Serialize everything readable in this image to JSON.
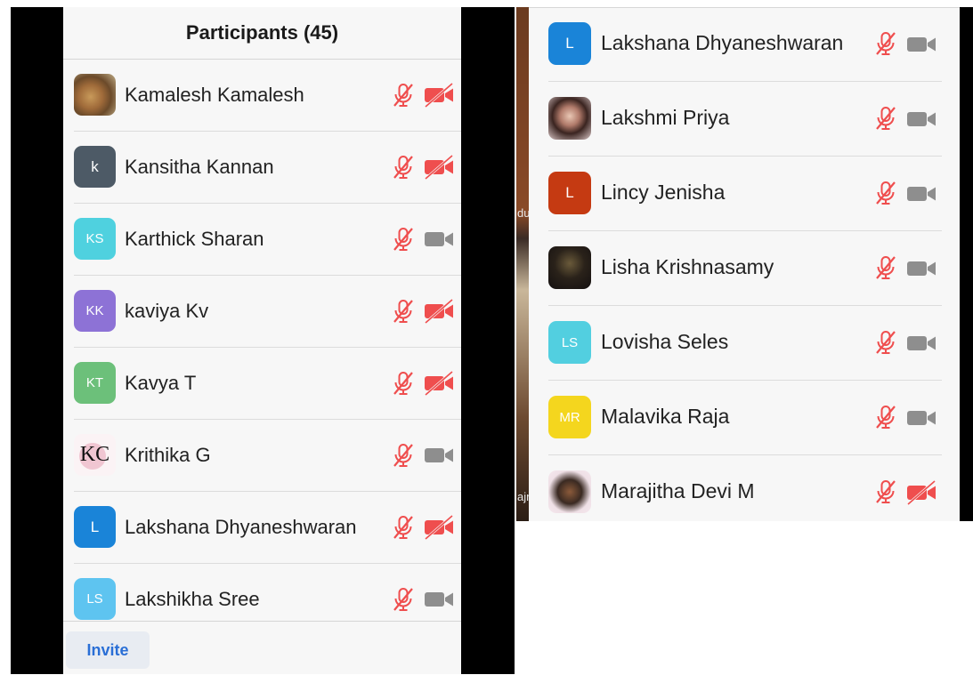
{
  "left": {
    "title": "Participants (45)",
    "invite_label": "Invite",
    "participants": [
      {
        "name": "Kamalesh Kamalesh",
        "initials": "",
        "avatar": "photo-lion",
        "color": "",
        "video_off": true
      },
      {
        "name": "Kansitha Kannan",
        "initials": "k",
        "avatar": "initials",
        "color": "#4d5a66",
        "video_off": true
      },
      {
        "name": "Karthick Sharan",
        "initials": "KS",
        "avatar": "initials",
        "color": "#4fd1df",
        "video_off": false
      },
      {
        "name": "kaviya Kv",
        "initials": "KK",
        "avatar": "initials",
        "color": "#8d72d6",
        "video_off": true
      },
      {
        "name": "Kavya T",
        "initials": "KT",
        "avatar": "initials",
        "color": "#6cc07a",
        "video_off": true
      },
      {
        "name": "Krithika G",
        "initials": "KC",
        "avatar": "logo-kc",
        "color": "",
        "video_off": false
      },
      {
        "name": "Lakshana Dhyaneshwaran",
        "initials": "L",
        "avatar": "initials",
        "color": "#1a84d8",
        "video_off": true
      },
      {
        "name": "Lakshikha Sree",
        "initials": "LS",
        "avatar": "initials",
        "color": "#5ec4f0",
        "video_off": false
      }
    ]
  },
  "right": {
    "background_text": [
      "du",
      "ajn"
    ],
    "participants": [
      {
        "name": "Lakshana Dhyaneshwaran",
        "initials": "L",
        "avatar": "initials",
        "color": "#1a84d8",
        "video_off": false
      },
      {
        "name": "Lakshmi Priya",
        "initials": "",
        "avatar": "photo-girl",
        "color": "",
        "video_off": false
      },
      {
        "name": "Lincy Jenisha",
        "initials": "L",
        "avatar": "initials",
        "color": "#c53a12",
        "video_off": false
      },
      {
        "name": "Lisha Krishnasamy",
        "initials": "",
        "avatar": "photo-man",
        "color": "",
        "video_off": false
      },
      {
        "name": "Lovisha Seles",
        "initials": "LS",
        "avatar": "initials",
        "color": "#52cfe0",
        "video_off": false
      },
      {
        "name": "Malavika Raja",
        "initials": "MR",
        "avatar": "initials",
        "color": "#f4d61e",
        "video_off": false
      },
      {
        "name": "Marajitha Devi M",
        "initials": "",
        "avatar": "photo-girl2",
        "color": "",
        "video_off": true
      }
    ]
  },
  "colors": {
    "muted_red": "#ef4e4e",
    "camera_gray": "#8e8e8e",
    "invite_blue": "#2a6fd6"
  },
  "icons": {
    "mic": "mic-muted-icon",
    "camera_on": "camera-icon",
    "camera_off": "camera-off-icon"
  }
}
